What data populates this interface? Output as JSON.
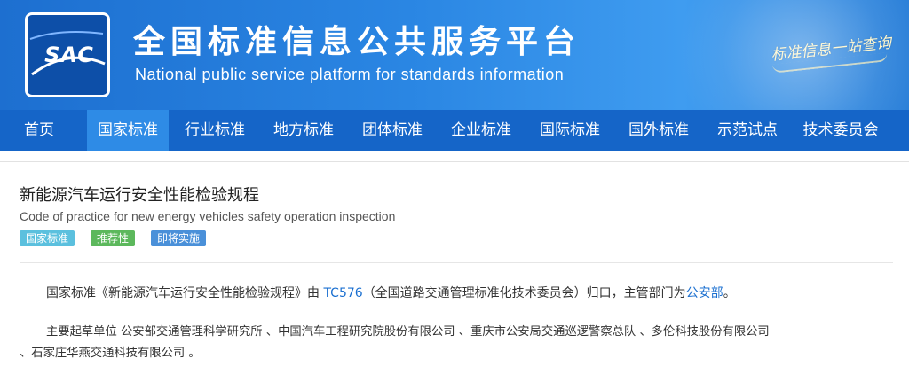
{
  "header": {
    "logo_text": "SAC",
    "title_cn": "全国标准信息公共服务平台",
    "title_en": "National public service platform  for standards information",
    "slogan": "标准信息一站查询"
  },
  "nav": {
    "items": [
      {
        "label": "首页"
      },
      {
        "label": "国家标准",
        "active": true
      },
      {
        "label": "行业标准"
      },
      {
        "label": "地方标准"
      },
      {
        "label": "团体标准"
      },
      {
        "label": "企业标准"
      },
      {
        "label": "国际标准"
      },
      {
        "label": "国外标准"
      },
      {
        "label": "示范试点"
      },
      {
        "label": "技术委员会"
      }
    ]
  },
  "standard": {
    "title_cn": "新能源汽车运行安全性能检验规程",
    "title_en": "Code of practice for new energy vehicles safety operation inspection",
    "tags": [
      {
        "label": "国家标准",
        "color": "#5bc0de"
      },
      {
        "label": "推荐性",
        "color": "#5cb85c"
      },
      {
        "label": "即将实施",
        "color": "#4a90d9"
      }
    ],
    "desc": {
      "p1_prefix": "国家标准《新能源汽车运行安全性能检验规程》由",
      "p1_tc": "TC576",
      "p1_mid": "（全国道路交通管理标准化技术委员会）归口，主管部门为",
      "p1_dept": "公安部",
      "p1_end": "。",
      "p2_line1": "主要起草单位 公安部交通管理科学研究所 、中国汽车工程研究院股份有限公司 、重庆市公安局交通巡逻警察总队 、多伦科技股份有限公司",
      "p2_line2": "、石家庄华燕交通科技有限公司 。"
    }
  },
  "colors": {
    "nav_bg": "#1565c8",
    "nav_active": "#2e8be6",
    "link": "#1a6fd0"
  }
}
